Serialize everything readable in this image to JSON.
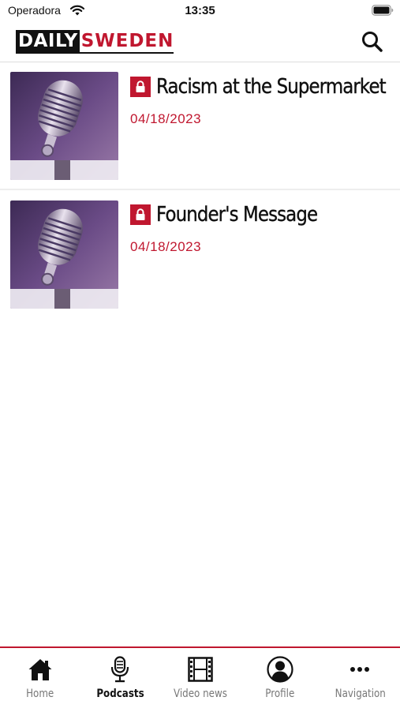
{
  "status_bar": {
    "carrier": "Operadora",
    "time": "13:35"
  },
  "header": {
    "logo_part1": "DAILY",
    "logo_part2": "SWEDEN",
    "search_icon": "search-icon"
  },
  "colors": {
    "brand_red": "#c0172f",
    "text": "#111111",
    "inactive_tab": "#777777"
  },
  "podcasts": [
    {
      "title": "Racism at the Supermarket",
      "date": "04/18/2023",
      "locked": true,
      "thumbnail_icon": "microphone-image"
    },
    {
      "title": "Founder's Message",
      "date": "04/18/2023",
      "locked": true,
      "thumbnail_icon": "microphone-image"
    }
  ],
  "tab_bar": {
    "active": "Podcasts",
    "tabs": [
      {
        "label": "Home",
        "icon": "home-icon"
      },
      {
        "label": "Podcasts",
        "icon": "microphone-icon"
      },
      {
        "label": "Video news",
        "icon": "film-icon"
      },
      {
        "label": "Profile",
        "icon": "profile-icon"
      },
      {
        "label": "Navigation",
        "icon": "more-icon"
      }
    ]
  }
}
